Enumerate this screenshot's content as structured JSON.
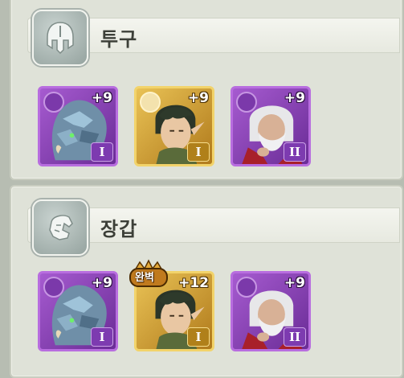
{
  "sections": [
    {
      "category": "투구",
      "category_icon": "helmet-icon",
      "cards": [
        {
          "rarity_color": "#9b4fc8",
          "character": "armored-beast",
          "enhancement": "+9",
          "tier": "I"
        },
        {
          "rarity_color": "#d9a93a",
          "character": "elf-man",
          "enhancement": "+9",
          "tier": "I"
        },
        {
          "rarity_color": "#9b4fc8",
          "character": "old-wizard",
          "enhancement": "+9",
          "tier": "II"
        }
      ]
    },
    {
      "category": "장갑",
      "category_icon": "gauntlet-icon",
      "cards": [
        {
          "rarity_color": "#9b4fc8",
          "character": "armored-beast",
          "enhancement": "+9",
          "tier": "I"
        },
        {
          "rarity_color": "#d9a93a",
          "character": "elf-man",
          "enhancement": "+12",
          "tier": "I",
          "badge": "완벽"
        },
        {
          "rarity_color": "#9b4fc8",
          "character": "old-wizard",
          "enhancement": "+9",
          "tier": "II"
        }
      ]
    }
  ]
}
